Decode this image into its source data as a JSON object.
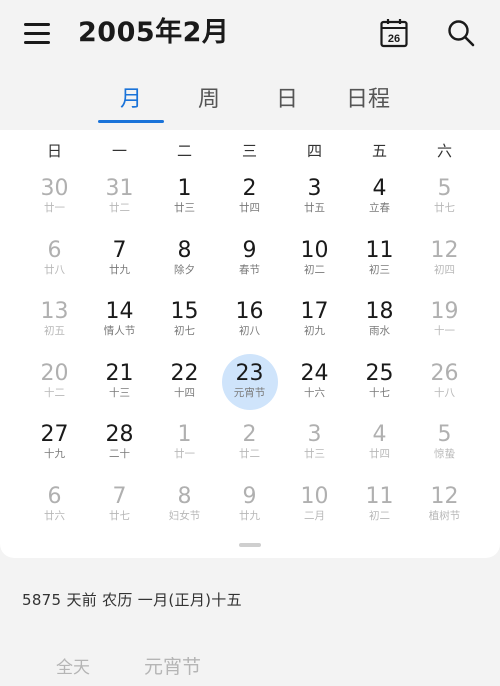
{
  "header": {
    "title": "2005年2月",
    "today_icon_day": "26"
  },
  "tabs": [
    {
      "label": "月",
      "active": true
    },
    {
      "label": "周",
      "active": false
    },
    {
      "label": "日",
      "active": false
    },
    {
      "label": "日程",
      "active": false
    }
  ],
  "weekdays": [
    "日",
    "一",
    "二",
    "三",
    "四",
    "五",
    "六"
  ],
  "weeks": [
    [
      {
        "num": "30",
        "lunar": "廿一",
        "muted": true
      },
      {
        "num": "31",
        "lunar": "廿二",
        "muted": true
      },
      {
        "num": "1",
        "lunar": "廿三"
      },
      {
        "num": "2",
        "lunar": "廿四"
      },
      {
        "num": "3",
        "lunar": "廿五"
      },
      {
        "num": "4",
        "lunar": "立春"
      },
      {
        "num": "5",
        "lunar": "廿七",
        "muted": true
      }
    ],
    [
      {
        "num": "6",
        "lunar": "廿八",
        "muted": true
      },
      {
        "num": "7",
        "lunar": "廿九"
      },
      {
        "num": "8",
        "lunar": "除夕"
      },
      {
        "num": "9",
        "lunar": "春节"
      },
      {
        "num": "10",
        "lunar": "初二"
      },
      {
        "num": "11",
        "lunar": "初三"
      },
      {
        "num": "12",
        "lunar": "初四",
        "muted": true
      }
    ],
    [
      {
        "num": "13",
        "lunar": "初五",
        "muted": true
      },
      {
        "num": "14",
        "lunar": "情人节"
      },
      {
        "num": "15",
        "lunar": "初七"
      },
      {
        "num": "16",
        "lunar": "初八"
      },
      {
        "num": "17",
        "lunar": "初九"
      },
      {
        "num": "18",
        "lunar": "雨水"
      },
      {
        "num": "19",
        "lunar": "十一",
        "muted": true
      }
    ],
    [
      {
        "num": "20",
        "lunar": "十二",
        "muted": true
      },
      {
        "num": "21",
        "lunar": "十三"
      },
      {
        "num": "22",
        "lunar": "十四"
      },
      {
        "num": "23",
        "lunar": "元宵节",
        "selected": true
      },
      {
        "num": "24",
        "lunar": "十六"
      },
      {
        "num": "25",
        "lunar": "十七"
      },
      {
        "num": "26",
        "lunar": "十八",
        "muted": true
      }
    ],
    [
      {
        "num": "27",
        "lunar": "十九"
      },
      {
        "num": "28",
        "lunar": "二十"
      },
      {
        "num": "1",
        "lunar": "廿一",
        "muted": true
      },
      {
        "num": "2",
        "lunar": "廿二",
        "muted": true
      },
      {
        "num": "3",
        "lunar": "廿三",
        "muted": true
      },
      {
        "num": "4",
        "lunar": "廿四",
        "muted": true
      },
      {
        "num": "5",
        "lunar": "惊蛰",
        "muted": true
      }
    ],
    [
      {
        "num": "6",
        "lunar": "廿六",
        "muted": true
      },
      {
        "num": "7",
        "lunar": "廿七",
        "muted": true
      },
      {
        "num": "8",
        "lunar": "妇女节",
        "muted": true
      },
      {
        "num": "9",
        "lunar": "廿九",
        "muted": true
      },
      {
        "num": "10",
        "lunar": "二月",
        "muted": true
      },
      {
        "num": "11",
        "lunar": "初二",
        "muted": true
      },
      {
        "num": "12",
        "lunar": "植树节",
        "muted": true
      }
    ]
  ],
  "info": {
    "text": "5875 天前  农历 一月(正月)十五"
  },
  "event": {
    "time": "全天",
    "title": "元宵节"
  },
  "colors": {
    "accent": "#1a73d9",
    "selected_bg": "#cfe4fb",
    "muted_text": "#b0b0b0"
  }
}
